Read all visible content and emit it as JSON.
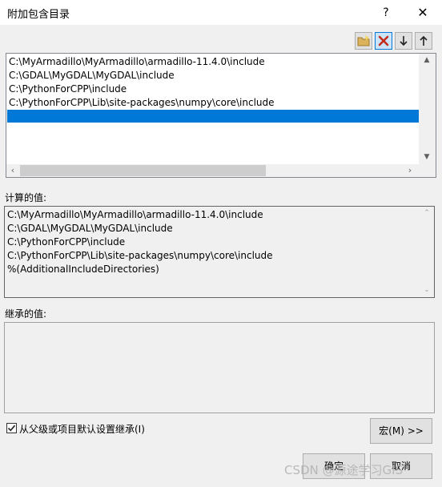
{
  "window": {
    "title": "附加包含目录",
    "help_label": "?",
    "close_label": "✕"
  },
  "toolbar": {
    "new_line_icon": "new-folder-icon",
    "delete_icon": "delete-x-icon",
    "move_down_icon": "arrow-down-icon",
    "move_up_icon": "arrow-up-icon",
    "delete_color": "#c42b1c"
  },
  "edit_list": {
    "lines": [
      "C:\\MyArmadillo\\MyArmadillo\\armadillo-11.4.0\\include",
      "C:\\GDAL\\MyGDAL\\MyGDAL\\include",
      "C:\\PythonForCPP\\include",
      "C:\\PythonForCPP\\Lib\\site-packages\\numpy\\core\\include",
      ""
    ],
    "selected_color": "#0078d7"
  },
  "computed": {
    "label": "计算的值:",
    "lines": [
      "C:\\MyArmadillo\\MyArmadillo\\armadillo-11.4.0\\include",
      "C:\\GDAL\\MyGDAL\\MyGDAL\\include",
      "C:\\PythonForCPP\\include",
      "C:\\PythonForCPP\\Lib\\site-packages\\numpy\\core\\include",
      "%(AdditionalIncludeDirectories)"
    ]
  },
  "inherited": {
    "label": "继承的值:"
  },
  "options": {
    "inherit_label": "从父级或项目默认设置继承(I)",
    "inherit_checked": true
  },
  "buttons": {
    "macro": "宏(M) >>",
    "ok": "确定",
    "cancel": "取消"
  },
  "watermark": "CSDN @源途学习GIS"
}
